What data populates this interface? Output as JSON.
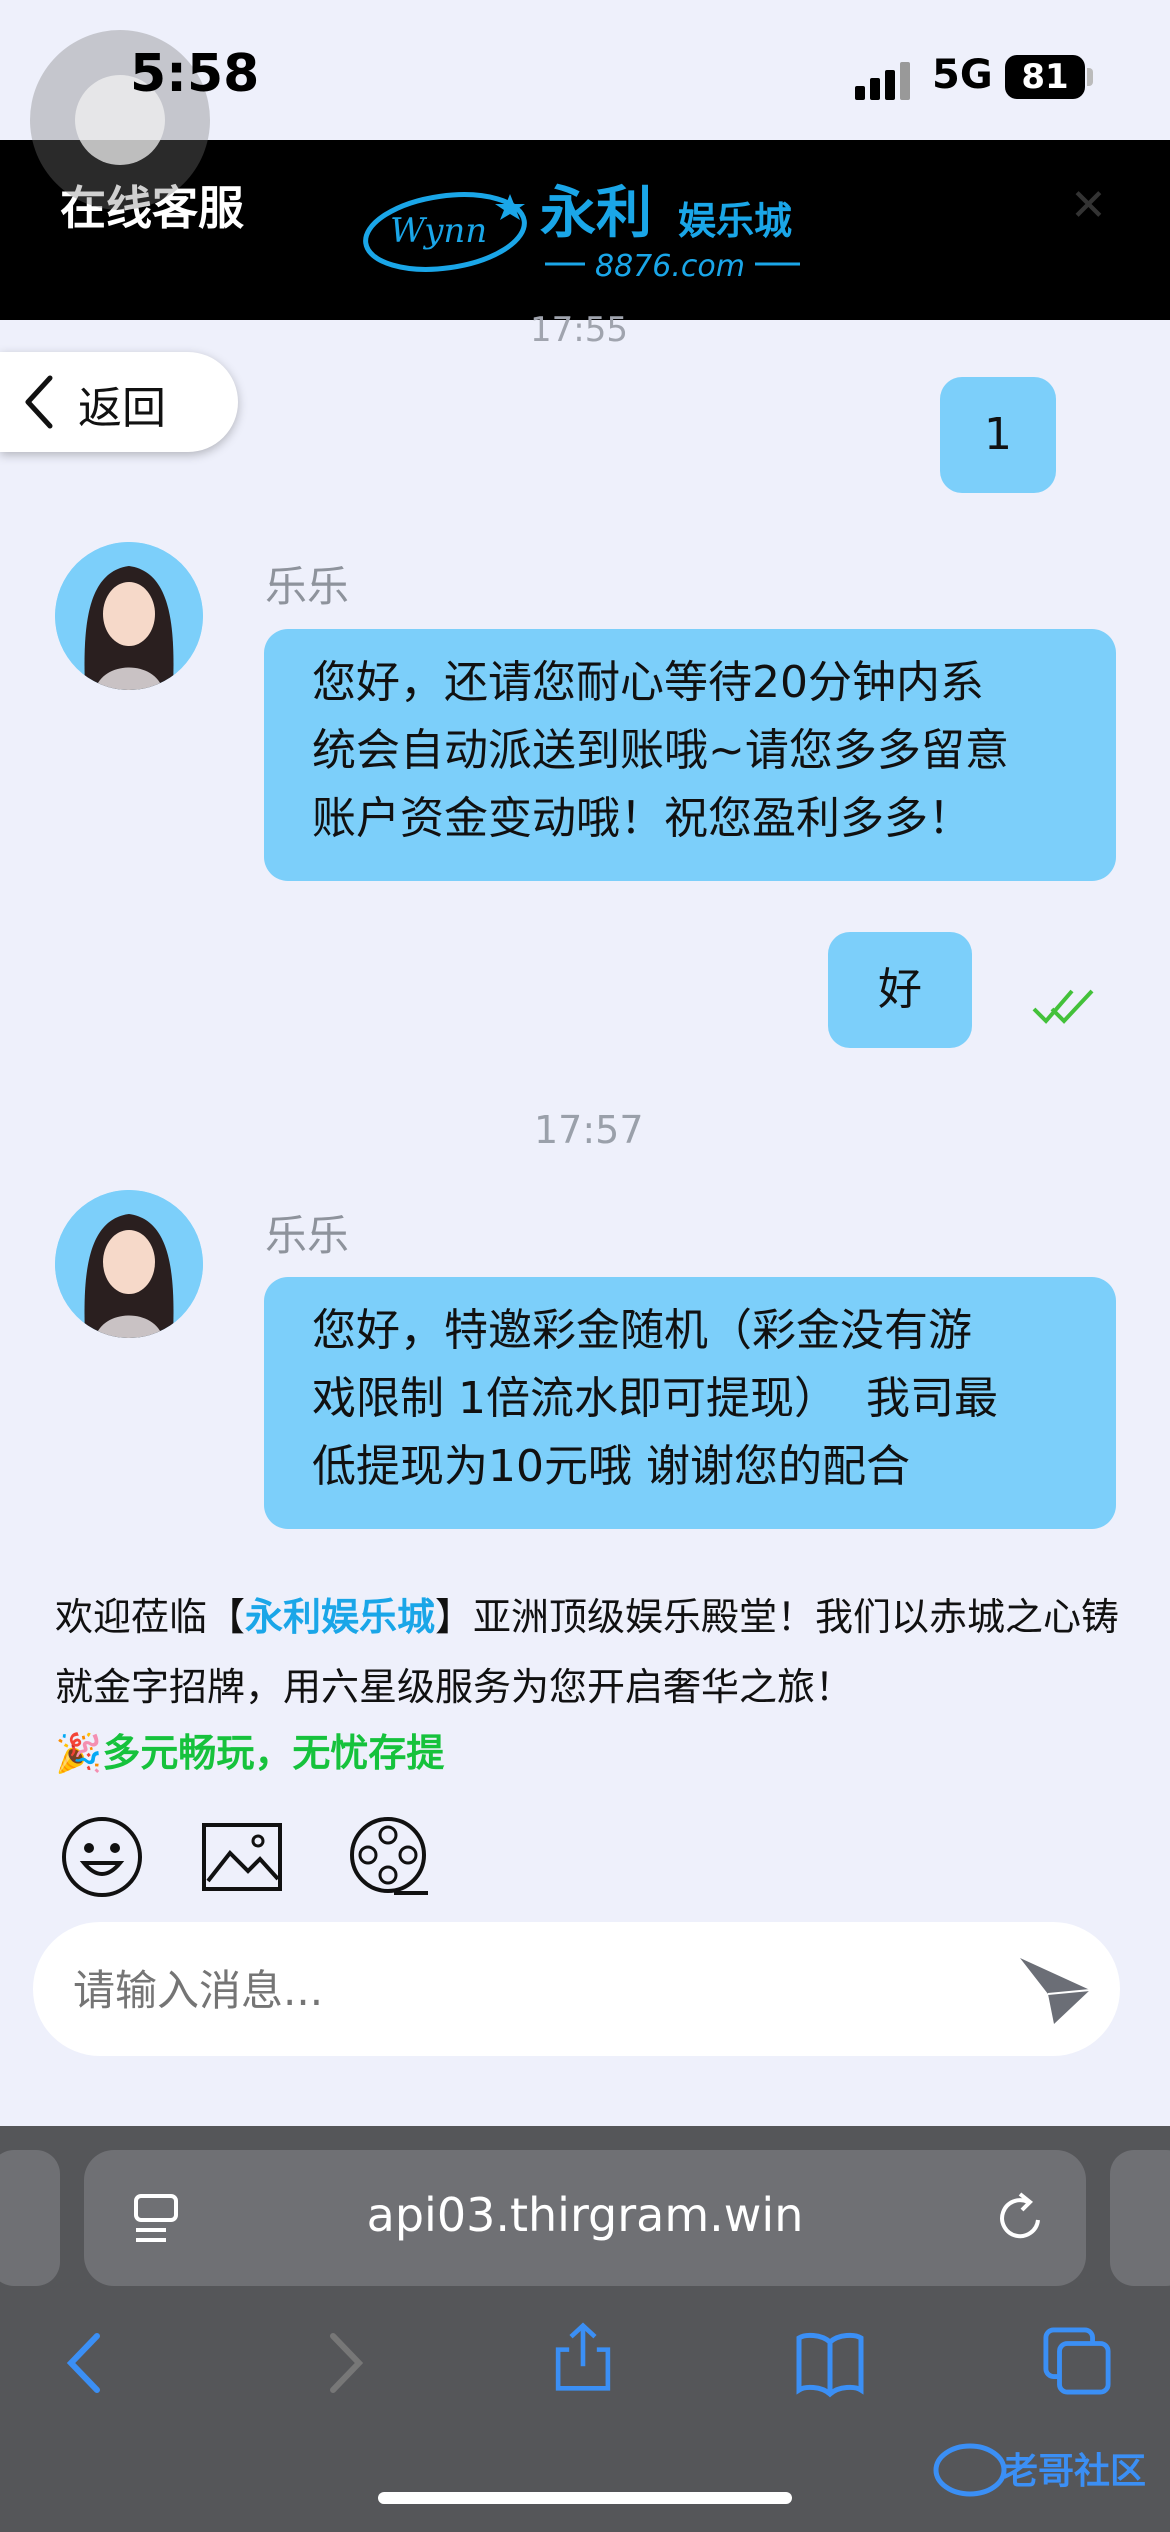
{
  "status_bar": {
    "time": "5:58",
    "network": "5G",
    "battery": "81"
  },
  "header": {
    "title": "在线客服",
    "logo_text": "永利",
    "logo_sub": "娱乐城",
    "logo_domain": "8876.com",
    "logo_script": "Wynn"
  },
  "back_label": "返回",
  "cut_timestamp": "17:55",
  "messages": [
    {
      "from": "user",
      "text": "1"
    },
    {
      "from": "agent",
      "name": "乐乐",
      "lines": [
        "您好，还请您耐心等待20分钟内系",
        "统会自动派送到账哦~请您多多留意",
        "账户资金变动哦！祝您盈利多多！"
      ]
    },
    {
      "from": "user",
      "text": "好",
      "read": true
    },
    {
      "timestamp": "17:57"
    },
    {
      "from": "agent",
      "name": "乐乐",
      "lines": [
        "您好，特邀彩金随机（彩金没有游",
        "戏限制 1倍流水即可提现）  我司最",
        "低提现为10元哦 谢谢您的配合"
      ]
    }
  ],
  "welcome": {
    "prefix": "欢迎莅临【",
    "highlight": "永利娱乐城",
    "suffix": "】亚洲顶级娱乐殿堂！我们以赤城之心铸就金字招牌，用六星级服务为您开启奢华之旅！",
    "promo_icon": "party-popper-icon",
    "promo": "多元畅玩，无忧存提"
  },
  "toolbar": [
    "emoji-icon",
    "image-icon",
    "video-icon"
  ],
  "input": {
    "placeholder": "请输入消息..."
  },
  "browser": {
    "url": "api03.thirgram.win"
  },
  "colors": {
    "bubble": "#7ccffa",
    "highlight": "#1aa6e8",
    "promo": "#16c23c",
    "read_check": "#43c13a",
    "header_bg": "#000000"
  },
  "watermark": "老哥社区"
}
